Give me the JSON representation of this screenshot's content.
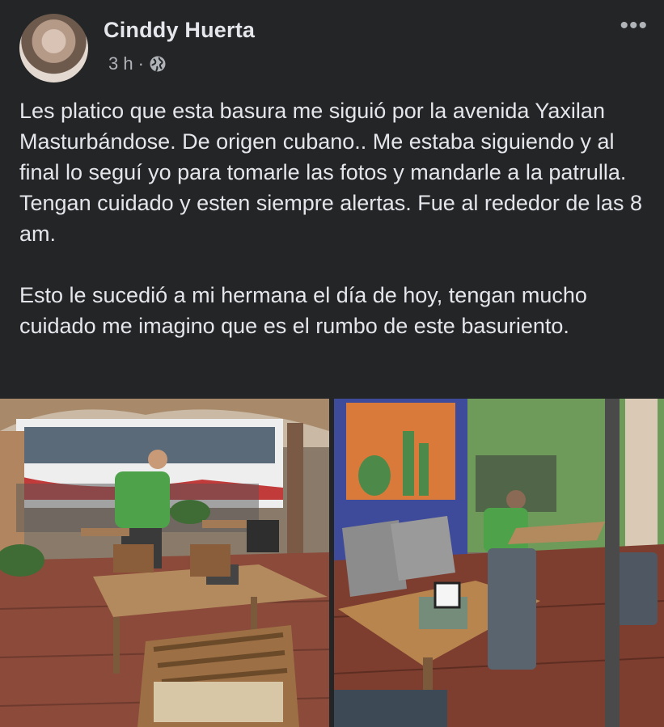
{
  "post": {
    "author": "Cinddy Huerta",
    "time": "3 h",
    "separator": "·",
    "privacy_icon": "globe-icon",
    "more_label": "•••",
    "text_paragraphs": [
      "Les platico que esta basura me siguió  por la avenida Yaxilan Masturbándose. De origen cubano.. Me estaba siguiendo  y al final lo seguí yo para tomarle las fotos y mandarle a la patrulla. Tengan cuidado y esten siempre alertas. Fue al rededor de las 8 am.",
      "Esto le sucedió a mi hermana el día de hoy, tengan mucho cuidado me imagino que es el rumbo de este basuriento."
    ]
  },
  "photos": [
    "restaurant-patio-photo-1",
    "restaurant-patio-photo-2"
  ],
  "colors": {
    "background": "#242526",
    "primary_text": "#e4e6eb",
    "secondary_text": "#b0b3b8"
  }
}
